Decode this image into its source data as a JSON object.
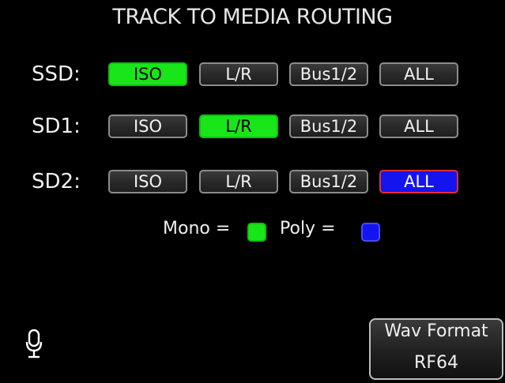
{
  "title": "TRACK TO MEDIA ROUTING",
  "colors": {
    "mono_green": "#19e619",
    "poly_blue": "#1414f0",
    "selected_blue_border": "#e03030"
  },
  "rows": [
    {
      "label": "SSD:",
      "buttons": [
        "ISO",
        "L/R",
        "Bus1/2",
        "ALL"
      ],
      "selected": "ISO",
      "selected_mode": "Mono"
    },
    {
      "label": "SD1:",
      "buttons": [
        "ISO",
        "L/R",
        "Bus1/2",
        "ALL"
      ],
      "selected": "L/R",
      "selected_mode": "Mono"
    },
    {
      "label": "SD2:",
      "buttons": [
        "ISO",
        "L/R",
        "Bus1/2",
        "ALL"
      ],
      "selected": "ALL",
      "selected_mode": "Poly"
    }
  ],
  "legend": {
    "mono_label": "Mono =",
    "poly_label": "Poly ="
  },
  "icons": {
    "mic": "microphone-icon"
  },
  "format_button": {
    "line1": "Wav Format",
    "line2": "RF64"
  }
}
